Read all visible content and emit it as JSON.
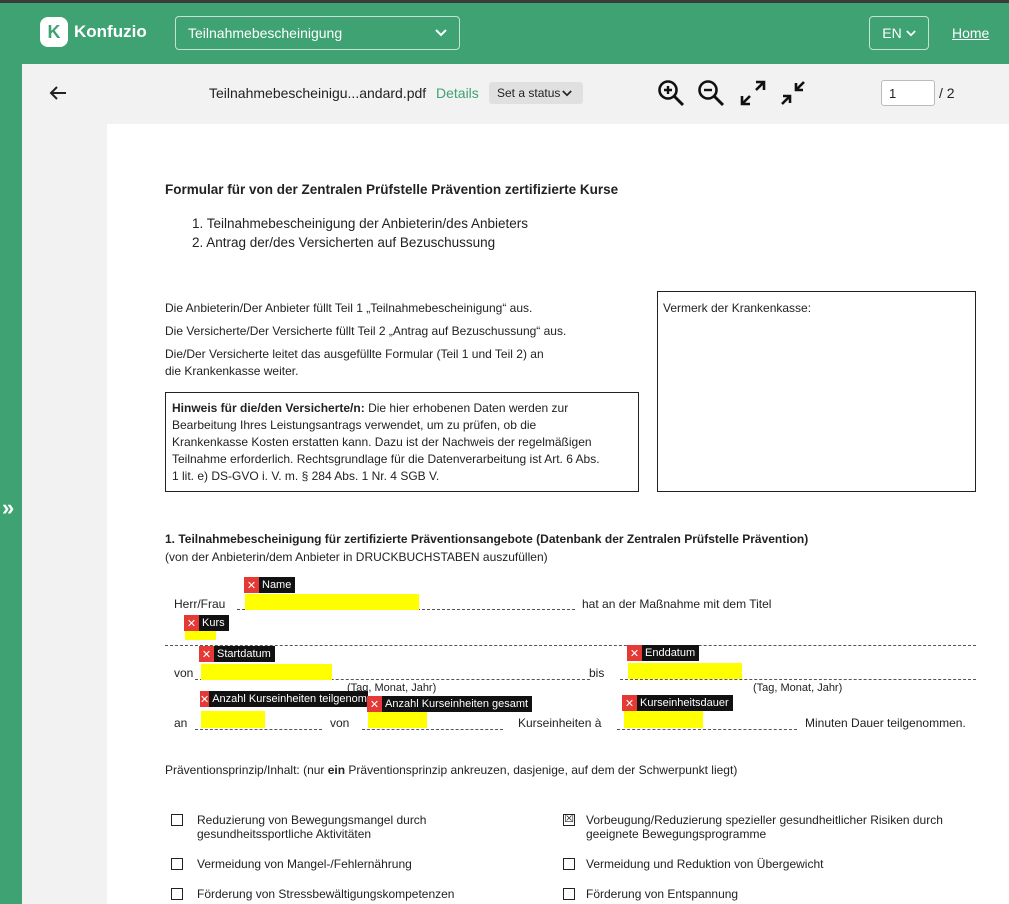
{
  "header": {
    "logo_letter": "K",
    "logo_text": "Konfuzio",
    "document_select": "Teilnahmebescheinigung",
    "language": "EN",
    "home_link": "Home"
  },
  "toolbar": {
    "filename": "Teilnahmebescheinigu...andard.pdf",
    "details_link": "Details",
    "status_placeholder": "Set a status",
    "page_current": "1",
    "page_total": "/ 2"
  },
  "document": {
    "title": "Formular für von der Zentralen Prüfstelle Prävention zertifizierte Kurse",
    "list": [
      "1.  Teilnahmebescheinigung der Anbieterin/des Anbieters",
      "2.  Antrag der/des Versicherten auf Bezuschussung"
    ],
    "para1": "Die Anbieterin/Der Anbieter füllt Teil 1 „Teilnahmebescheinigung“ aus.",
    "para2": "Die Versicherte/Der Versicherte füllt Teil 2 „Antrag auf Bezuschussung“ aus.",
    "para3a": "Die/Der Versicherte leitet das ausgefüllte Formular (Teil 1 und Teil 2) an",
    "para3b": "die Krankenkasse weiter.",
    "hint_bold": "Hinweis für die/den Versicherte/n:",
    "hint_lines": [
      " Die hier erhobenen Daten werden zur",
      "Bearbeitung Ihres Leistungsantrags verwendet, um zu prüfen, ob die",
      "Krankenkasse Kosten erstatten kann. Dazu ist der Nachweis der regelmäßigen",
      "Teilnahme erforderlich. Rechtsgrundlage für die Datenverarbeitung ist Art. 6 Abs.",
      "1 lit. e) DS-GVO i. V. m. § 284 Abs. 1 Nr. 4 SGB V."
    ],
    "vermerk": "Vermerk der Krankenkasse:",
    "section_title": "1. Teilnahmebescheinigung für zertifizierte Präventionsangebote (Datenbank der Zentralen Prüfstelle Prävention)",
    "section_sub": "(von der Anbieterin/dem Anbieter in DRUCKBUCHSTABEN auszufüllen)",
    "herr_frau": "Herr/Frau",
    "hat_an": "hat an der Maßnahme mit dem Titel",
    "von": "von",
    "bis": "bis",
    "date_hint": "(Tag, Monat, Jahr)",
    "an": "an",
    "von2": "von",
    "kurseinheiten": "Kurseinheiten à",
    "minuten": "Minuten Dauer teilgenommen.",
    "prinzip_pre": "Präventionsprinzip/Inhalt: (nur ",
    "prinzip_bold": "ein",
    "prinzip_post": " Präventionsprinzip ankreuzen, dasjenige, auf dem der Schwerpunkt liegt)",
    "options": [
      {
        "l1": "Reduzierung von Bewegungsmangel durch",
        "l2": "gesundheitssportliche Aktivitäten",
        "checked": false
      },
      {
        "l1": "Vorbeugung/Reduzierung spezieller gesundheitlicher Risiken durch",
        "l2": "geeignete Bewegungsprogramme",
        "checked": true
      },
      {
        "l1": "Vermeidung von Mangel-/Fehlernährung",
        "l2": "",
        "checked": false
      },
      {
        "l1": "Vermeidung und Reduktion von Übergewicht",
        "l2": "",
        "checked": false
      },
      {
        "l1": "Förderung von Stressbewältigungskompetenzen",
        "l2": "",
        "checked": false
      },
      {
        "l1": "Förderung von Entspannung",
        "l2": "",
        "checked": false
      }
    ],
    "check_mark": "☒"
  },
  "annotations": {
    "name": "Name",
    "kurs": "Kurs",
    "startdatum": "Startdatum",
    "enddatum": "Enddatum",
    "anzahl_teilgenommen": "Anzahl Kurseinheiten teilgenommen",
    "anzahl_gesamt": "Anzahl Kurseinheiten gesamt",
    "kurseinheitsdauer": "Kurseinheitsdauer",
    "remove_glyph": "✕"
  },
  "colors": {
    "brand": "#3ea273",
    "highlight": "#ffff00",
    "remove": "#e53935"
  }
}
